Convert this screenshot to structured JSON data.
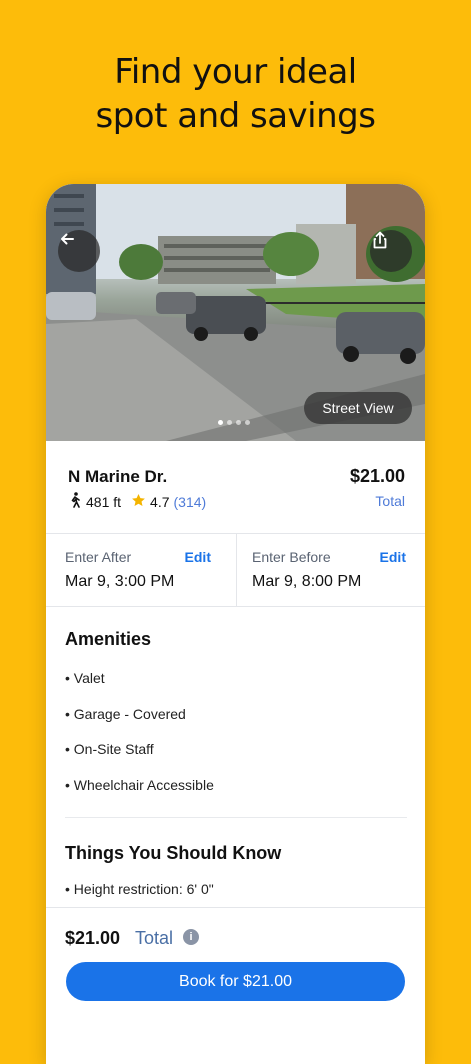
{
  "headline": {
    "line1": "Find your ideal",
    "line2": "spot and savings"
  },
  "photo": {
    "street_view_label": "Street View",
    "dots_total": 4,
    "dots_active_index": 0
  },
  "listing": {
    "name": "N Marine Dr.",
    "distance": "481 ft",
    "rating": "4.7",
    "review_count": "(314)",
    "price": "$21.00",
    "price_label": "Total"
  },
  "times": {
    "enter_after": {
      "label": "Enter After",
      "edit": "Edit",
      "value": "Mar 9, 3:00 PM"
    },
    "enter_before": {
      "label": "Enter Before",
      "edit": "Edit",
      "value": "Mar 9, 8:00 PM"
    }
  },
  "amenities": {
    "title": "Amenities",
    "items": [
      "• Valet",
      "• Garage - Covered",
      "• On-Site Staff",
      "• Wheelchair Accessible"
    ]
  },
  "know": {
    "title": "Things You Should Know",
    "items": [
      "• Height restriction: 6' 0\""
    ]
  },
  "footer": {
    "price": "$21.00",
    "total_label": "Total",
    "info_symbol": "i",
    "book_label": "Book for $21.00"
  },
  "colors": {
    "background": "#FDBC0A",
    "accent": "#1a73e8",
    "link": "#4f7bd8",
    "star": "#F4B400"
  },
  "icons": [
    "back-arrow-icon",
    "share-icon",
    "walking-icon",
    "star-icon",
    "info-icon"
  ]
}
